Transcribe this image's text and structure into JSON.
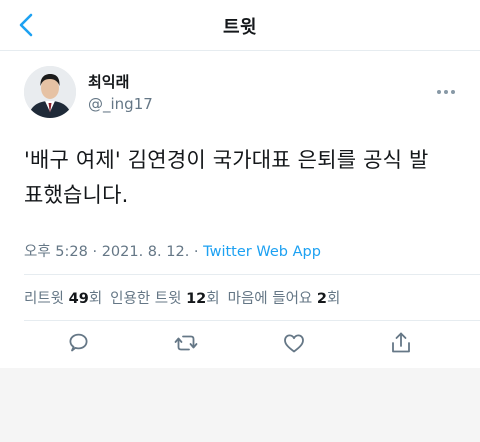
{
  "header": {
    "title": "트윗"
  },
  "tweet": {
    "author_name": "최익래",
    "author_handle": "@_ing17",
    "text_line1": "'배구 여제' 김연경이 국가대표 은퇴를 공식 발",
    "text_line2": "표했습니다.",
    "time": "오후 5:28",
    "dot1": " · ",
    "date": "2021. 8. 12.",
    "dot2": " · ",
    "source_app": "Twitter Web App"
  },
  "stats": {
    "retweets_label": "리트윗",
    "retweets_count": "49",
    "retweets_unit": "회",
    "quotes_label": "인용한 트윗",
    "quotes_count": "12",
    "quotes_unit": "회",
    "likes_label": "마음에 들어요",
    "likes_count": "2",
    "likes_unit": "회"
  },
  "icons": {
    "back": "chevron-left-icon",
    "more": "more-icon",
    "reply": "comment-icon",
    "retweet": "retweet-icon",
    "like": "heart-icon",
    "share": "share-icon"
  },
  "colors": {
    "accent": "#1da1f2",
    "secondary_text": "#657786",
    "action_icon": "#657786"
  }
}
